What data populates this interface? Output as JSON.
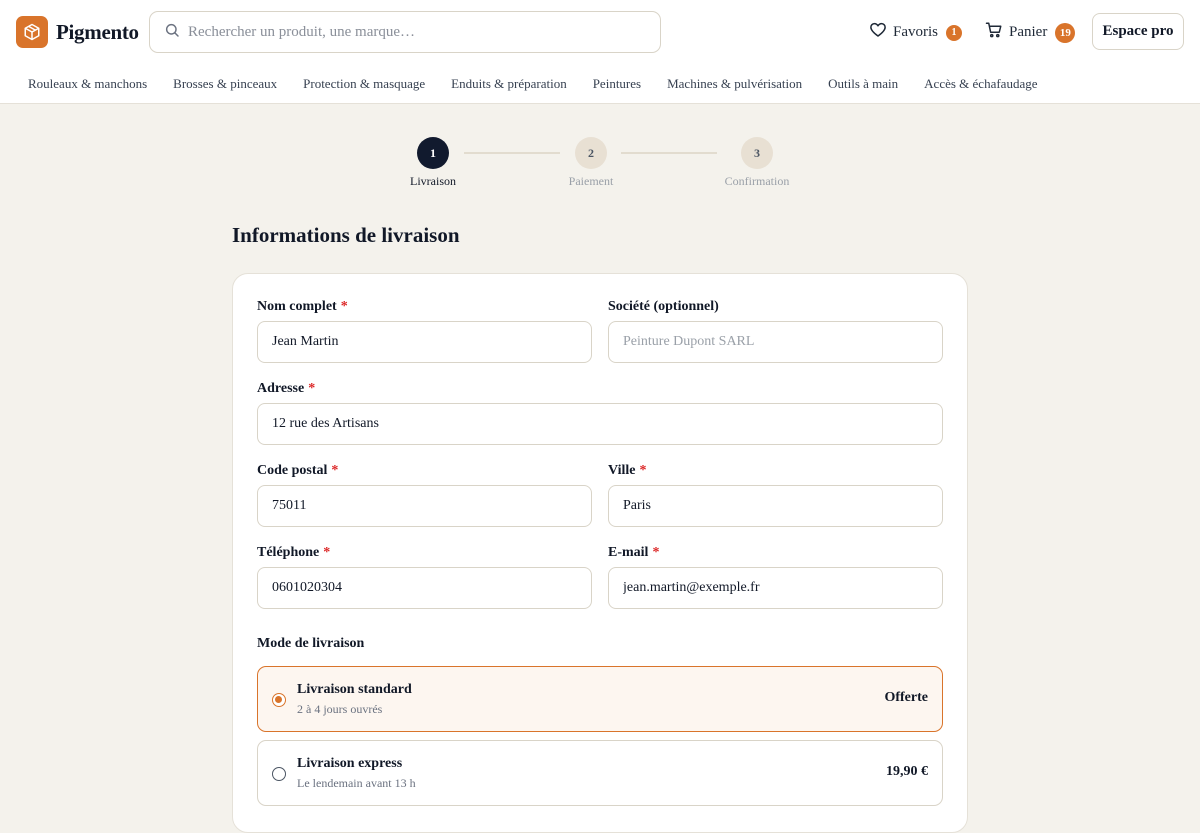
{
  "brand": {
    "name": "Pigmento",
    "logo_icon": "box-icon",
    "accent": "#d9742b"
  },
  "search": {
    "placeholder": "Rechercher un produit, une marque…",
    "value": ""
  },
  "header": {
    "favorites": {
      "label": "Favoris",
      "count": "1"
    },
    "cart": {
      "label": "Panier",
      "count": "19"
    },
    "pro_button": "Espace pro"
  },
  "nav": [
    "Rouleaux & manchons",
    "Brosses & pinceaux",
    "Protection & masquage",
    "Enduits & préparation",
    "Peintures",
    "Machines & pulvérisation",
    "Outils à main",
    "Accès & échafaudage"
  ],
  "steps": [
    {
      "num": "1",
      "label": "Livraison",
      "active": true
    },
    {
      "num": "2",
      "label": "Paiement",
      "active": false
    },
    {
      "num": "3",
      "label": "Confirmation",
      "active": false
    }
  ],
  "section_title": "Informations de livraison",
  "form": {
    "full_name": {
      "label": "Nom complet",
      "required": "*",
      "value": "Jean Martin"
    },
    "company": {
      "label": "Société (optionnel)",
      "placeholder": "Peinture Dupont SARL",
      "value": ""
    },
    "address": {
      "label": "Adresse",
      "required": "*",
      "value": "12 rue des Artisans"
    },
    "postal_code": {
      "label": "Code postal",
      "required": "*",
      "value": "75011"
    },
    "city": {
      "label": "Ville",
      "required": "*",
      "value": "Paris"
    },
    "phone": {
      "label": "Téléphone",
      "required": "*",
      "value": "0601020304"
    },
    "email": {
      "label": "E-mail",
      "required": "*",
      "value": "jean.martin@exemple.fr"
    }
  },
  "shipping": {
    "title": "Mode de livraison",
    "options": [
      {
        "name": "Livraison standard",
        "detail": "2 à 4 jours ouvrés",
        "price": "Offerte",
        "selected": true
      },
      {
        "name": "Livraison express",
        "detail": "Le lendemain avant 13 h",
        "price": "19,90 €",
        "selected": false
      }
    ]
  }
}
